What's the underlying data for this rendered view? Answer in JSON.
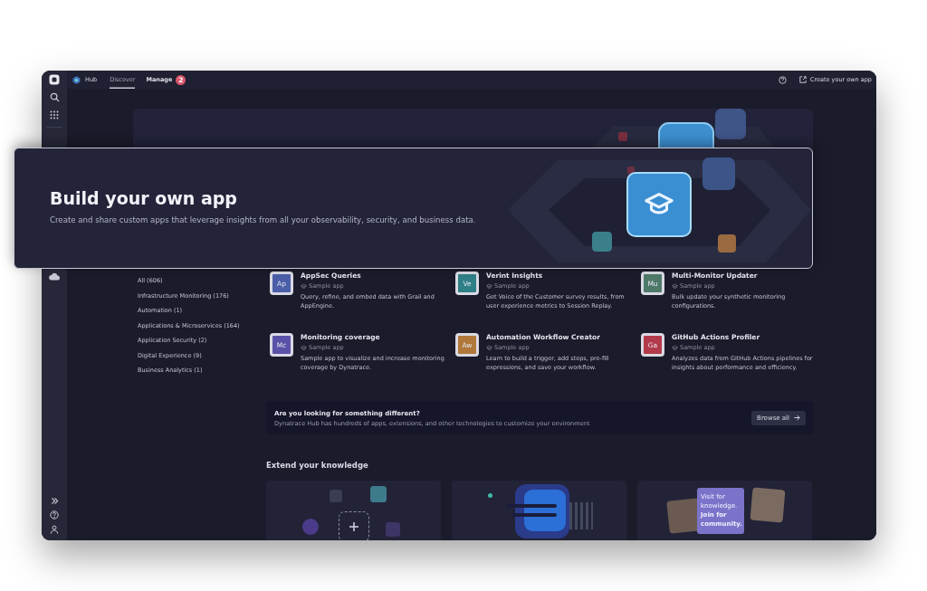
{
  "topbar": {
    "app_name": "Hub",
    "tabs": [
      {
        "label": "Discover",
        "selected": true
      },
      {
        "label": "Manage",
        "selected": false,
        "badge": "2"
      }
    ],
    "create_link": "Create your own app"
  },
  "overlay": {
    "title": "Build your own app",
    "text": "Create and share custom apps that leverage insights from all your observability, security, and business data."
  },
  "categories": [
    "All (606)",
    "Infrastructure Monitoring (176)",
    "Automation (1)",
    "Applications & Microservices (164)",
    "Application Security (2)",
    "Digital Experience (9)",
    "Business Analytics (1)"
  ],
  "apps": [
    {
      "abbr": "Ap",
      "title": "AppSec Queries",
      "tag": "Sample app",
      "description": "Query, refine, and embed data with Grail and AppEngine.",
      "color": "#4b5ea8"
    },
    {
      "abbr": "Ve",
      "title": "Verint Insights",
      "tag": "Sample app",
      "description": "Get Voice of the Customer survey results, from user experience metrics to Session Replay.",
      "color": "#2f7f86"
    },
    {
      "abbr": "Mu",
      "title": "Multi-Monitor Updater",
      "tag": "Sample app",
      "description": "Bulk update your synthetic monitoring configurations.",
      "color": "#4f7a6a"
    },
    {
      "abbr": "Mc",
      "title": "Monitoring coverage",
      "tag": "Sample app",
      "description": "Sample app to visualize and increase monitoring coverage by Dynatrace.",
      "color": "#5a52a8"
    },
    {
      "abbr": "Aw",
      "title": "Automation Workflow Creator",
      "tag": "Sample app",
      "description": "Learn to build a trigger, add steps, pre-fill expressions, and save your workflow.",
      "color": "#b0783a"
    },
    {
      "abbr": "Ga",
      "title": "GitHub Actions Profiler",
      "tag": "Sample app",
      "description": "Analyzes data from GitHub Actions pipelines for insights about performance and efficiency.",
      "color": "#b23a4a"
    }
  ],
  "promo": {
    "title": "Are you looking for something different?",
    "text": "Dynatrace Hub has hundreds of apps, extensions, and other technologies to customize your environment",
    "button": "Browse all"
  },
  "knowledge": {
    "heading": "Extend your knowledge",
    "cards": [
      {
        "kind": "integrations"
      },
      {
        "kind": "docs"
      },
      {
        "kind": "community",
        "text": "Visit for knowledge. **Join for community.**"
      }
    ]
  }
}
